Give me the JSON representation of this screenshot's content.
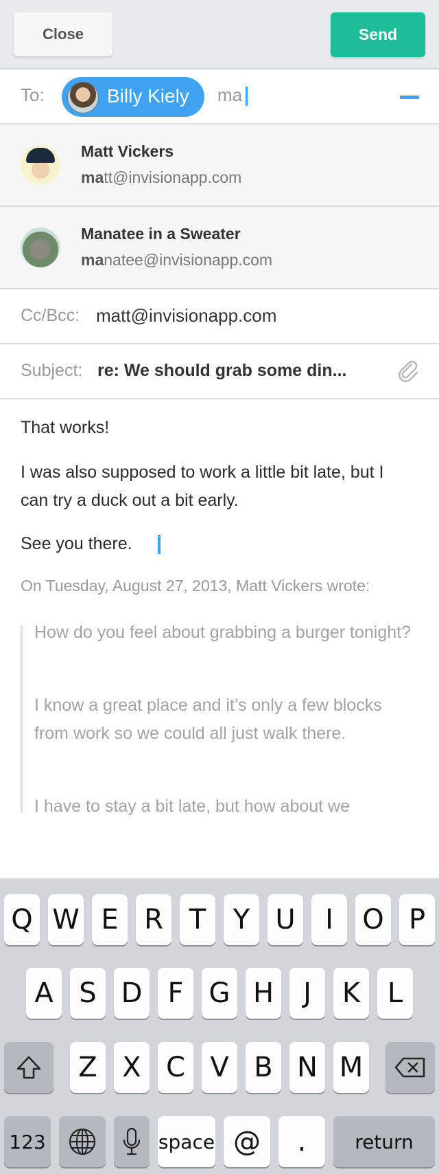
{
  "toolbar": {
    "close_label": "Close",
    "send_label": "Send"
  },
  "to": {
    "label": "To:",
    "recipient_chip": "Billy Kiely",
    "typed_text": "ma"
  },
  "suggestions": [
    {
      "name": "Matt Vickers",
      "email_match": "ma",
      "email_rest": "tt@invisionapp.com"
    },
    {
      "name": "Manatee in a Sweater",
      "email_match": "ma",
      "email_rest": "natee@invisionapp.com"
    }
  ],
  "cc": {
    "label": "Cc/Bcc:",
    "value": "matt@invisionapp.com"
  },
  "subject": {
    "label": "Subject:",
    "value": "re: We should grab some din..."
  },
  "body": {
    "p1": "That works!",
    "p2": "I was also supposed to work a little bit late, but I can try a duck out a bit early.",
    "p3": "See you there.",
    "quote_header": "On Tuesday, August 27, 2013, Matt Vickers wrote:",
    "quote_p1": "How do you feel about grabbing a burger tonight?",
    "quote_p2": "I know a great place and it’s only a few blocks from work so we could all just walk there.",
    "quote_p3": "I have to stay a bit late, but how about we"
  },
  "keyboard": {
    "row1": [
      "Q",
      "W",
      "E",
      "R",
      "T",
      "Y",
      "U",
      "I",
      "O",
      "P"
    ],
    "row2": [
      "A",
      "S",
      "D",
      "F",
      "G",
      "H",
      "J",
      "K",
      "L"
    ],
    "row3": [
      "Z",
      "X",
      "C",
      "V",
      "B",
      "N",
      "M"
    ],
    "numbers_label": "123",
    "space_label": "space",
    "at_label": "@",
    "period_label": ".",
    "return_label": "return"
  },
  "colors": {
    "accent": "#3fa3f1",
    "send": "#1fbc99"
  }
}
